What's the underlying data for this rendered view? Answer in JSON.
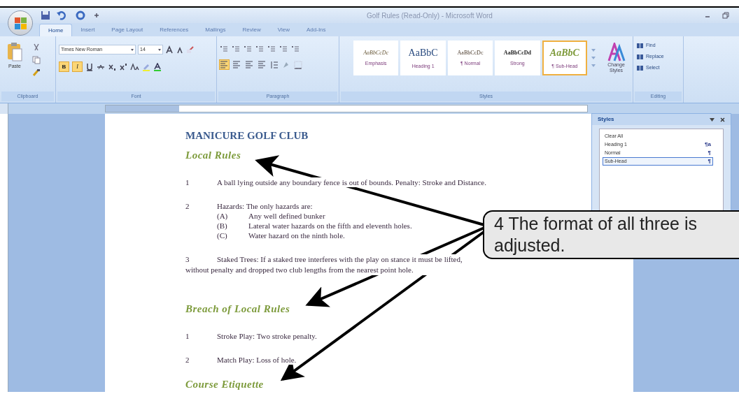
{
  "window": {
    "title": "Golf Rules (Read-Only) - Microsoft Word"
  },
  "tabs": [
    {
      "label": "Home",
      "selected": true
    },
    {
      "label": "Insert",
      "selected": false
    },
    {
      "label": "Page Layout",
      "selected": false
    },
    {
      "label": "References",
      "selected": false
    },
    {
      "label": "Mailings",
      "selected": false
    },
    {
      "label": "Review",
      "selected": false
    },
    {
      "label": "View",
      "selected": false
    },
    {
      "label": "Add-Ins",
      "selected": false
    }
  ],
  "ribbon": {
    "clipboard": {
      "paste": "Paste",
      "label": "Clipboard"
    },
    "font": {
      "name": "Times New Roman",
      "size": "14",
      "label": "Font",
      "format_buttons": [
        {
          "label": "B",
          "on": true
        },
        {
          "label": "I",
          "on": true
        }
      ]
    },
    "paragraph": {
      "label": "Paragraph",
      "align_left_on": true
    },
    "styles": {
      "label": "Styles",
      "gallery": [
        {
          "preview": "AaBbCcDc",
          "name": "Emphasis",
          "selected": false
        },
        {
          "preview": "AaBbC",
          "name": "Heading 1",
          "selected": false
        },
        {
          "preview": "AaBbCcDc",
          "name": "¶ Normal",
          "selected": false
        },
        {
          "preview": "AaBbCcDd",
          "name": "Strong",
          "selected": false
        },
        {
          "preview": "AaBbC",
          "name": "¶ Sub-Head",
          "selected": true
        }
      ],
      "change_styles": "Change Styles"
    },
    "editing": {
      "label": "Editing",
      "commands": [
        "Find",
        "Replace",
        "Select"
      ]
    }
  },
  "document": {
    "title": "MANICURE GOLF CLUB",
    "blocks": [
      {
        "kind": "subhead",
        "text": "Local Rules"
      },
      {
        "kind": "numbered",
        "number": "1",
        "text": "A ball lying outside any boundary fence is out of bounds.  Penalty: Stroke and Distance."
      },
      {
        "kind": "numbered",
        "number": "2",
        "text": "Hazards:  The only hazards are:",
        "sub_items": [
          {
            "letter": "(A)",
            "text": "Any well defined bunker"
          },
          {
            "letter": "(B)",
            "text": "Lateral water hazards on the fifth and eleventh holes."
          },
          {
            "letter": "(C)",
            "text": "Water hazard on the ninth hole."
          }
        ]
      },
      {
        "kind": "paragraph",
        "number": "3",
        "text": "Staked Trees:  If a staked tree interferes with the play on stance it must be lifted, without penalty and dropped two club lengths from the nearest point hole."
      },
      {
        "kind": "subhead",
        "text": "Breach of Local Rules"
      },
      {
        "kind": "numbered",
        "number": "1",
        "text": "Stroke Play:  Two stroke penalty."
      },
      {
        "kind": "numbered",
        "number": "2",
        "text": "Match Play:  Loss of hole."
      },
      {
        "kind": "subhead",
        "text": "Course Etiquette"
      }
    ]
  },
  "styles_pane": {
    "title": "Styles",
    "items": [
      {
        "label": "Clear All",
        "selected": false
      },
      {
        "label": "Heading 1",
        "mark": "¶a",
        "selected": false
      },
      {
        "label": "Normal",
        "mark": "¶",
        "selected": false
      },
      {
        "label": "Sub-Head",
        "mark": "¶",
        "selected": true
      }
    ]
  },
  "callout": {
    "text": "4  The format of all three is adjusted."
  }
}
